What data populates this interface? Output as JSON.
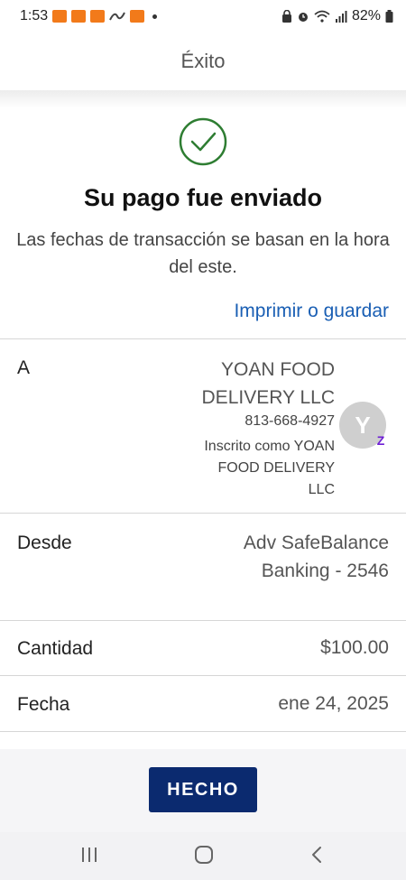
{
  "status_bar": {
    "time": "1:53",
    "battery": "82%",
    "app_badges": [
      "app-badge",
      "app-badge",
      "app-badge",
      "app-badge"
    ],
    "icons": [
      "lock-icon",
      "alarm-icon",
      "wifi-icon",
      "signal-icon",
      "battery-icon"
    ]
  },
  "header": {
    "title": "Éxito"
  },
  "success": {
    "title": "Su pago fue enviado",
    "subtitle": "Las fechas de transacción se basan en la hora del este.",
    "print_link": "Imprimir o guardar",
    "icon": "check-circle-icon",
    "accent": "#2e7d32"
  },
  "details": {
    "to": {
      "label": "A",
      "name": "YOAN FOOD DELIVERY LLC",
      "phone": "813-668-4927",
      "enrolled": "Inscrito como YOAN FOOD DELIVERY LLC",
      "avatar_initial": "Y",
      "badge": "Z"
    },
    "from": {
      "label": "Desde",
      "value": "Adv SafeBalance Banking - 2546"
    },
    "amount": {
      "label": "Cantidad",
      "value": "$100.00"
    },
    "date": {
      "label": "Fecha",
      "value": "ene 24, 2025"
    }
  },
  "footer": {
    "done_label": "HECHO",
    "button_color": "#0b2a6f"
  },
  "nav": {
    "items": [
      "recent-apps-icon",
      "home-icon",
      "back-icon"
    ]
  }
}
